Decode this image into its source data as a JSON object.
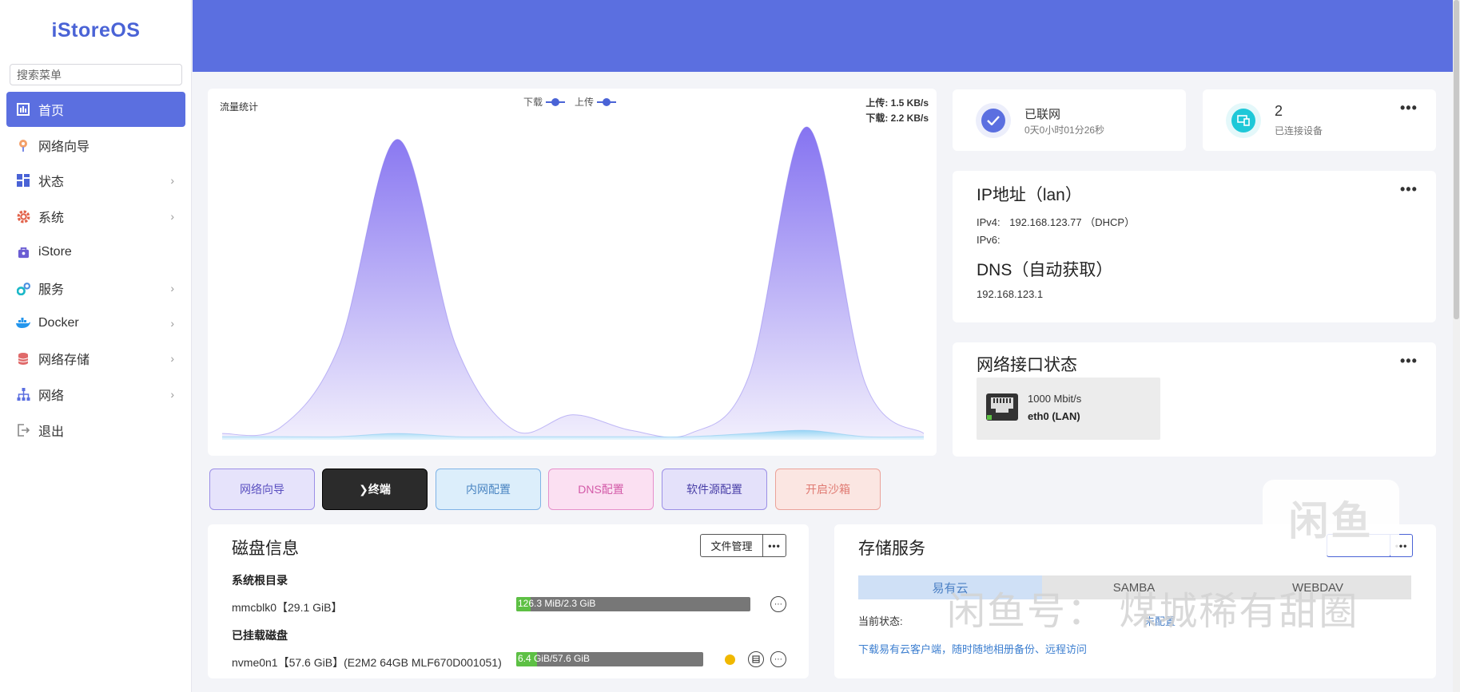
{
  "app": {
    "logo": "iStoreOS"
  },
  "search": {
    "placeholder": "搜索菜单"
  },
  "sidebar": {
    "items": [
      {
        "label": "首页",
        "icon": "dashboard-icon",
        "active": true,
        "has_submenu": false
      },
      {
        "label": "网络向导",
        "icon": "wizard-icon",
        "active": false,
        "has_submenu": false
      },
      {
        "label": "状态",
        "icon": "status-icon",
        "active": false,
        "has_submenu": true
      },
      {
        "label": "系统",
        "icon": "gear-icon",
        "active": false,
        "has_submenu": true
      },
      {
        "label": "iStore",
        "icon": "store-icon",
        "active": false,
        "has_submenu": false
      },
      {
        "label": "服务",
        "icon": "services-icon",
        "active": false,
        "has_submenu": true
      },
      {
        "label": "Docker",
        "icon": "docker-icon",
        "active": false,
        "has_submenu": true
      },
      {
        "label": "网络存储",
        "icon": "database-icon",
        "active": false,
        "has_submenu": true
      },
      {
        "label": "网络",
        "icon": "network-icon",
        "active": false,
        "has_submenu": true
      },
      {
        "label": "退出",
        "icon": "logout-icon",
        "active": false,
        "has_submenu": false
      }
    ]
  },
  "traffic": {
    "title": "流量统计",
    "legend_download": "下载",
    "legend_upload": "上传",
    "upload_rate": "上传: 1.5 KB/s",
    "download_rate": "下载: 2.2 KB/s"
  },
  "chart_data": {
    "type": "area",
    "title": "流量统计",
    "series": [
      {
        "name": "下载",
        "color": "#8a7cf0",
        "values": [
          2,
          4,
          30,
          96,
          30,
          3,
          8,
          3,
          2,
          20,
          100,
          18,
          2
        ]
      },
      {
        "name": "上传",
        "color": "#7cc6f0",
        "values": [
          1,
          1,
          1,
          2,
          1,
          1,
          1,
          1,
          1,
          2,
          3,
          1,
          1
        ]
      }
    ],
    "grid": false,
    "legend": "top-center"
  },
  "connection": {
    "status": "已联网",
    "uptime": "0天0小时01分26秒",
    "color": "#5b6fe0"
  },
  "devices": {
    "count": "2",
    "label": "已连接设备",
    "color": "#1ec8d8"
  },
  "ip": {
    "title": "IP地址（lan）",
    "ipv4_label": "IPv4:",
    "ipv4_value": "192.168.123.77 （DHCP）",
    "ipv6_label": "IPv6:",
    "dns_title": "DNS（自动获取）",
    "dns_value": "192.168.123.1"
  },
  "interfaces": {
    "title": "网络接口状态",
    "items": [
      {
        "speed": "1000 Mbit/s",
        "name": "eth0 (LAN)"
      }
    ]
  },
  "quick_buttons": [
    {
      "label": "网络向导",
      "bg": "#e6e3fb",
      "border": "#9b8fe6",
      "color": "#5a4fc0"
    },
    {
      "label": "❯终端",
      "bg": "#2b2b2b",
      "border": "#000000",
      "color": "#ffffff"
    },
    {
      "label": "内网配置",
      "bg": "#dceefb",
      "border": "#7fb3e6",
      "color": "#4a85c2"
    },
    {
      "label": "DNS配置",
      "bg": "#fbe0f2",
      "border": "#e68fcb",
      "color": "#d35aa8"
    },
    {
      "label": "软件源配置",
      "bg": "#e4e1fa",
      "border": "#9b8fe6",
      "color": "#4a40a8"
    },
    {
      "label": "开启沙箱",
      "bg": "#fbe6e2",
      "border": "#eba39a",
      "color": "#e07a72"
    }
  ],
  "disk": {
    "title": "磁盘信息",
    "file_manager": "文件管理",
    "root_label": "系统根目录",
    "root_disk": "mmcblk0【29.1 GiB】",
    "root_usage": "126.3 MiB/2.3 GiB",
    "root_usage_fraction": 0.06,
    "mounted_label": "已挂载磁盘",
    "mounted_disk": "nvme0n1【57.6 GiB】(E2M2 64GB MLF670D001051)",
    "mounted_usage": "6.4 GiB/57.6 GiB",
    "mounted_usage_fraction": 0.11
  },
  "storage": {
    "title": "存储服务",
    "tabs": [
      "易有云",
      "SAMBA",
      "WEBDAV"
    ],
    "status_label": "当前状态:",
    "status_value": "未配置",
    "hint": "下载易有云客户端，随时随地相册备份、远程访问"
  },
  "watermark": {
    "logo": "闲鱼",
    "text": "闲鱼号： 煤城稀有甜圈"
  }
}
